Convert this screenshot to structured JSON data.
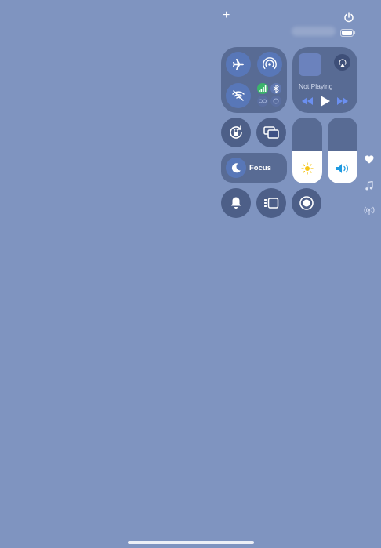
{
  "status_bar": {
    "battery_level": 1.0
  },
  "top_controls": {
    "add_glyph": "+",
    "power_icon": "power-icon"
  },
  "connectivity": {
    "airplane": {
      "icon": "airplane-icon",
      "active": true
    },
    "airdrop": {
      "icon": "airdrop-icon",
      "active": true
    },
    "wifi": {
      "icon": "wifi-off-icon",
      "active": true
    },
    "cellular": {
      "icon": "cellular-icon",
      "color": "#3bb56b"
    },
    "bluetooth": {
      "icon": "bluetooth-icon"
    },
    "personal_hotspot": {
      "icon": "link-icon"
    },
    "vpn": {
      "icon": "vpn-icon"
    }
  },
  "media": {
    "status": "Not Playing",
    "airplay_icon": "airplay-audio-icon",
    "controls": [
      "rewind-icon",
      "play-icon",
      "fast-forward-icon"
    ],
    "accent": "#6b8ff0"
  },
  "tiles": {
    "orientation_lock": "orientation-lock-icon",
    "screen_mirroring": "screen-mirroring-icon",
    "focus": {
      "label": "Focus",
      "icon": "moon-icon"
    }
  },
  "sliders": {
    "brightness": {
      "level": 0.5,
      "icon": "sun-icon",
      "icon_color": "#f5c518"
    },
    "volume": {
      "level": 0.5,
      "icon": "speaker-icon",
      "icon_color": "#1f9ae0"
    }
  },
  "bottom_row": [
    "bell-icon",
    "stage-manager-icon",
    "screen-recording-icon"
  ],
  "side_indicators": [
    "heart-icon",
    "music-note-icon",
    "signal-icon"
  ]
}
